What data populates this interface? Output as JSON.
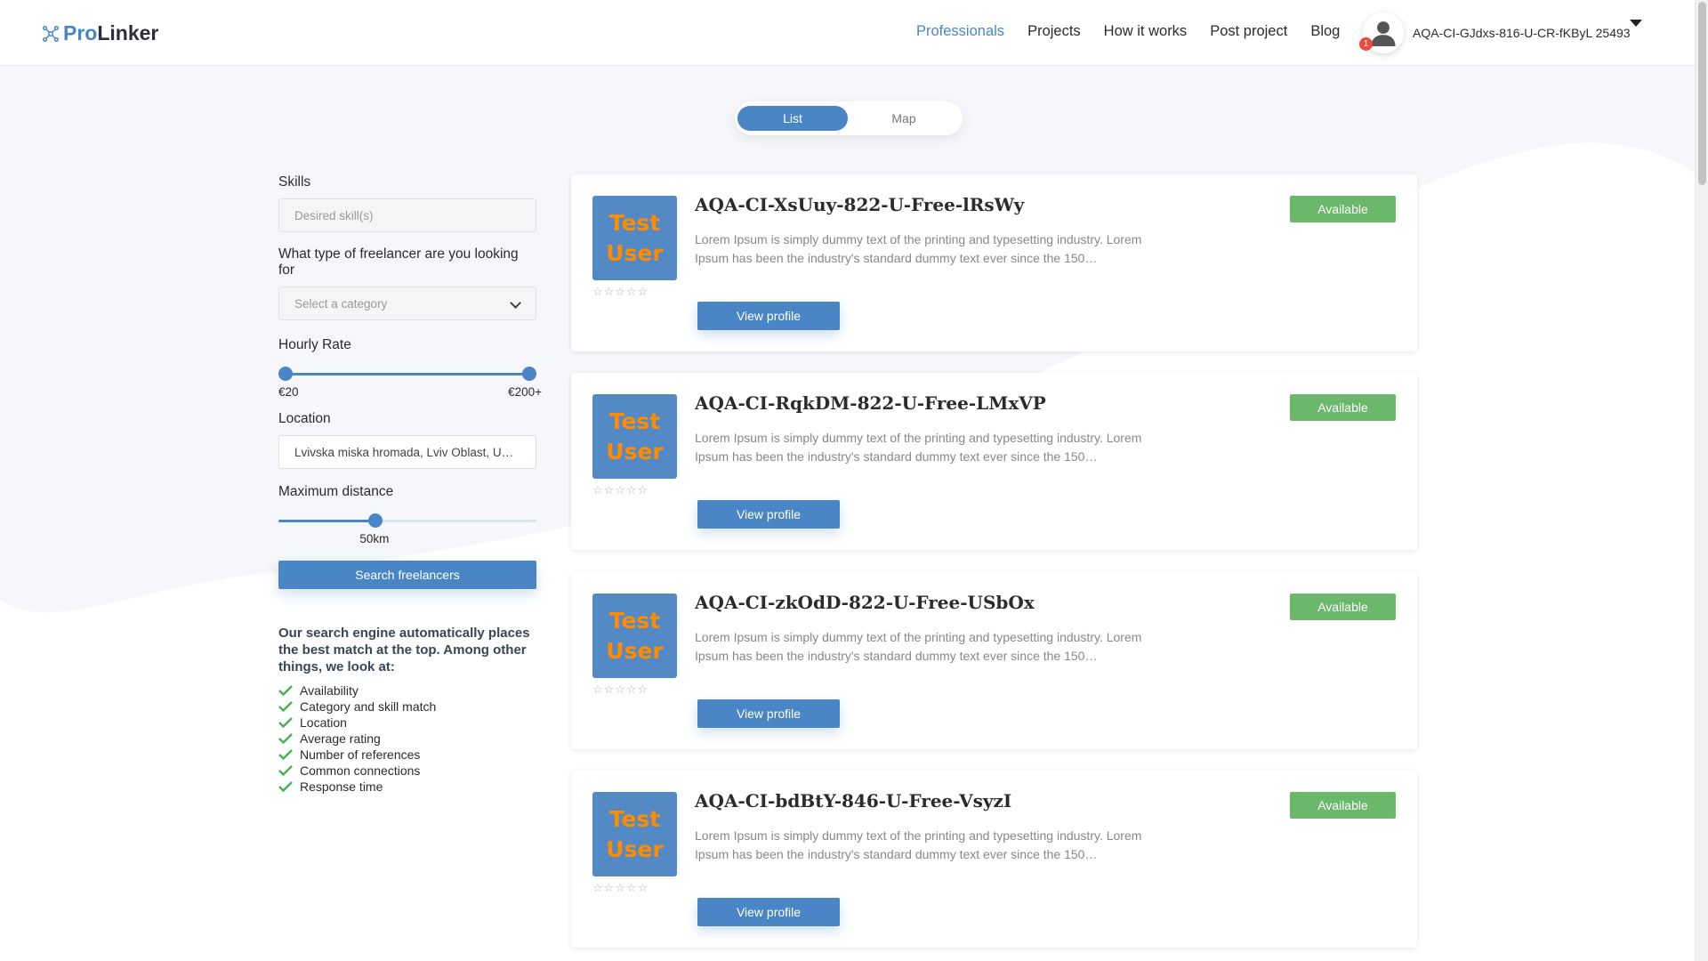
{
  "brand": {
    "pro": "Pro",
    "linker": "Linker"
  },
  "nav": [
    {
      "label": "Professionals",
      "active": true
    },
    {
      "label": "Projects",
      "active": false
    },
    {
      "label": "How it works",
      "active": false
    },
    {
      "label": "Post project",
      "active": false
    },
    {
      "label": "Blog",
      "active": false
    }
  ],
  "user": {
    "name": "AQA-CI-GJdxs-816-U-CR-fKByL 25493",
    "notifications": "1"
  },
  "view_toggle": {
    "list": "List",
    "map": "Map",
    "selected": "List"
  },
  "filters": {
    "skills": {
      "label": "Skills",
      "placeholder": "Desired skill(s)"
    },
    "category": {
      "label": "What type of freelancer are you looking for",
      "placeholder": "Select a category"
    },
    "hourly_rate": {
      "label": "Hourly Rate",
      "min": "€20",
      "max": "€200+",
      "min_fraction": 0.0,
      "max_fraction": 1.0
    },
    "location": {
      "label": "Location",
      "value": "Lvivska miska hromada, Lviv Oblast, U…"
    },
    "distance": {
      "label": "Maximum distance",
      "value": "50km",
      "fraction": 0.37
    },
    "search_button": "Search freelancers"
  },
  "info": {
    "text": "Our search engine automatically places the best match at the top. Among other things, we look at:",
    "criteria": [
      "Availability",
      "Category and skill match",
      "Location",
      "Average rating",
      "Number of references",
      "Common connections",
      "Response time"
    ]
  },
  "thumb_text": [
    "Test",
    "User"
  ],
  "colors": {
    "accent": "#4a86c5",
    "available": "#6cb86a",
    "thumb_text": "#ff8c00"
  },
  "freelancers": [
    {
      "name": "AQA-CI-XsUuy-822-U-Free-lRsWy",
      "description": "Lorem Ipsum is simply dummy text of the printing and typesetting industry. Lorem Ipsum has been the industry's standard dummy text ever since the 150…",
      "status": "Available",
      "rating": "☆☆☆☆☆",
      "button": "View profile"
    },
    {
      "name": "AQA-CI-RqkDM-822-U-Free-LMxVP",
      "description": "Lorem Ipsum is simply dummy text of the printing and typesetting industry. Lorem Ipsum has been the industry's standard dummy text ever since the 150…",
      "status": "Available",
      "rating": "☆☆☆☆☆",
      "button": "View profile"
    },
    {
      "name": "AQA-CI-zkOdD-822-U-Free-USbOx",
      "description": "Lorem Ipsum is simply dummy text of the printing and typesetting industry. Lorem Ipsum has been the industry's standard dummy text ever since the 150…",
      "status": "Available",
      "rating": "☆☆☆☆☆",
      "button": "View profile"
    },
    {
      "name": "AQA-CI-bdBtY-846-U-Free-VsyzI",
      "description": "Lorem Ipsum is simply dummy text of the printing and typesetting industry. Lorem Ipsum has been the industry's standard dummy text ever since the 150…",
      "status": "Available",
      "rating": "☆☆☆☆☆",
      "button": "View profile"
    }
  ]
}
